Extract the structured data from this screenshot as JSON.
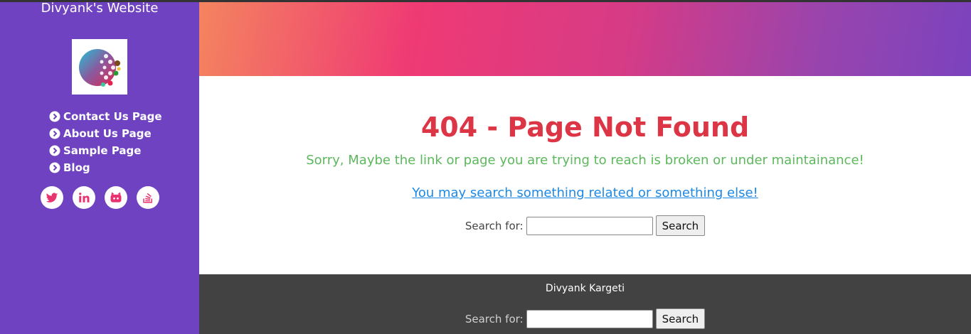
{
  "sidebar": {
    "site_title": "Divyank's Website",
    "logo_icon": "globe-logo",
    "nav": [
      {
        "label": "Contact Us Page",
        "icon": "chevron-circle-right-icon"
      },
      {
        "label": "About Us Page",
        "icon": "chevron-circle-right-icon"
      },
      {
        "label": "Sample Page",
        "icon": "chevron-circle-right-icon"
      },
      {
        "label": "Blog",
        "icon": "chevron-circle-right-icon"
      }
    ],
    "socials": [
      "twitter-icon",
      "linkedin-icon",
      "github-icon",
      "stackoverflow-icon"
    ],
    "bg_color": "#6f42c1"
  },
  "main": {
    "title": "404 - Page Not Found",
    "subtitle": "Sorry, Maybe the link or page you are trying to reach is broken or under maintainance!",
    "link_text": "You may search something related or something else!",
    "search": {
      "label": "Search for:",
      "value": "",
      "button": "Search"
    },
    "title_color": "#dc3545",
    "subtitle_color": "#5cb85c"
  },
  "footer": {
    "name": "Divyank Kargeti",
    "search": {
      "label": "Search for:",
      "value": "",
      "button": "Search"
    },
    "bg_color": "#424242"
  }
}
